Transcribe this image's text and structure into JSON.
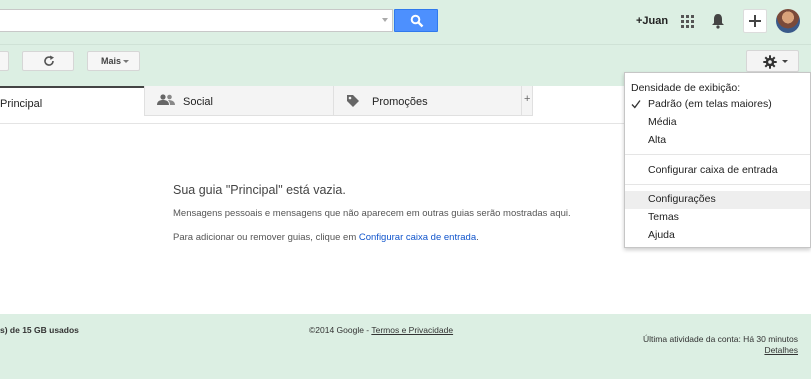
{
  "topbar": {
    "user_link": "+Juan"
  },
  "toolbar": {
    "more_label": "Mais"
  },
  "tabs": [
    {
      "label": "Principal"
    },
    {
      "label": "Social"
    },
    {
      "label": "Promoções"
    },
    {
      "label": "+"
    }
  ],
  "empty_state": {
    "title": "Sua guia \"Principal\" está vazia.",
    "description": "Mensagens pessoais e mensagens que não aparecem em outras guias serão mostradas aqui.",
    "hint_prefix": "Para adicionar ou remover guias, clique em ",
    "hint_link": "Configurar caixa de entrada",
    "hint_suffix": "."
  },
  "footer": {
    "storage": "s) de 15 GB usados",
    "copyright": "©2014 Google - ",
    "terms_link": "Termos e Privacidade",
    "last_activity": "Última atividade da conta: Há 30 minutos",
    "details_link": "Detalhes"
  },
  "settings_menu": {
    "density_heading": "Densidade de exibição:",
    "items": [
      {
        "label": "Padrão (em telas maiores)",
        "checked": true
      },
      {
        "label": "Média"
      },
      {
        "label": "Alta"
      },
      {
        "label": "Configurar caixa de entrada"
      },
      {
        "label": "Configurações",
        "highlighted": true
      },
      {
        "label": "Temas"
      },
      {
        "label": "Ajuda"
      }
    ]
  },
  "colors": {
    "background": "#dcefe3",
    "search_button": "#4d90fe",
    "link": "#1155cc"
  }
}
